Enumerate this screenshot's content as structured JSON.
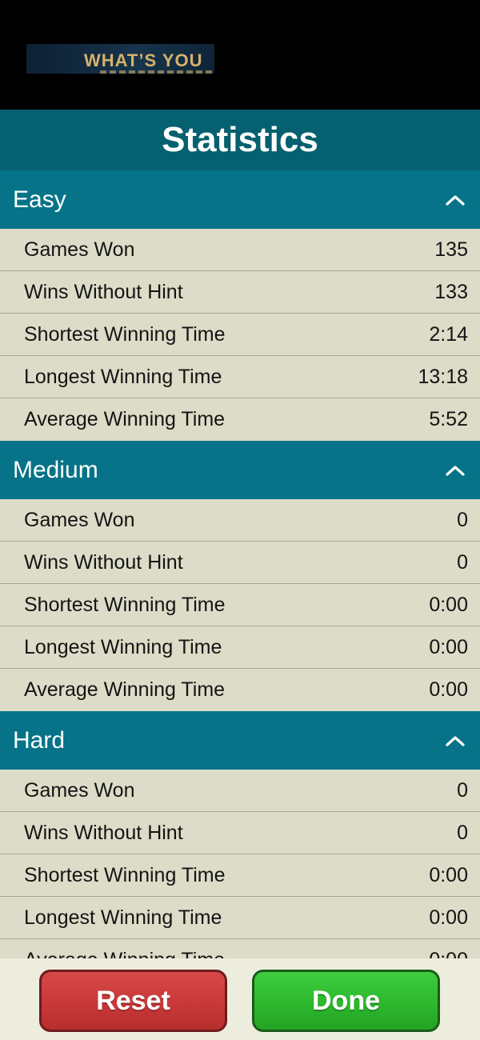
{
  "ad": {
    "text": "WHAT’S YOU"
  },
  "header": {
    "title": "Statistics"
  },
  "sections": [
    {
      "title": "Easy",
      "expanded": true,
      "rows": [
        {
          "label": "Games Won",
          "value": "135"
        },
        {
          "label": "Wins Without Hint",
          "value": "133"
        },
        {
          "label": "Shortest Winning Time",
          "value": "2:14"
        },
        {
          "label": "Longest Winning Time",
          "value": "13:18"
        },
        {
          "label": "Average Winning Time",
          "value": "5:52"
        }
      ]
    },
    {
      "title": "Medium",
      "expanded": true,
      "rows": [
        {
          "label": "Games Won",
          "value": "0"
        },
        {
          "label": "Wins Without Hint",
          "value": "0"
        },
        {
          "label": "Shortest Winning Time",
          "value": "0:00"
        },
        {
          "label": "Longest Winning Time",
          "value": "0:00"
        },
        {
          "label": "Average Winning Time",
          "value": "0:00"
        }
      ]
    },
    {
      "title": "Hard",
      "expanded": true,
      "rows": [
        {
          "label": "Games Won",
          "value": "0"
        },
        {
          "label": "Wins Without Hint",
          "value": "0"
        },
        {
          "label": "Shortest Winning Time",
          "value": "0:00"
        },
        {
          "label": "Longest Winning Time",
          "value": "0:00"
        },
        {
          "label": "Average Winning Time",
          "value": "0:00"
        }
      ]
    }
  ],
  "buttons": {
    "reset_label": "Reset",
    "done_label": "Done"
  },
  "colors": {
    "title_bar": "#05606f",
    "section_header": "#067388",
    "row_background": "#dcdcc8",
    "reset_button": "#c93838",
    "done_button": "#2db82d"
  }
}
